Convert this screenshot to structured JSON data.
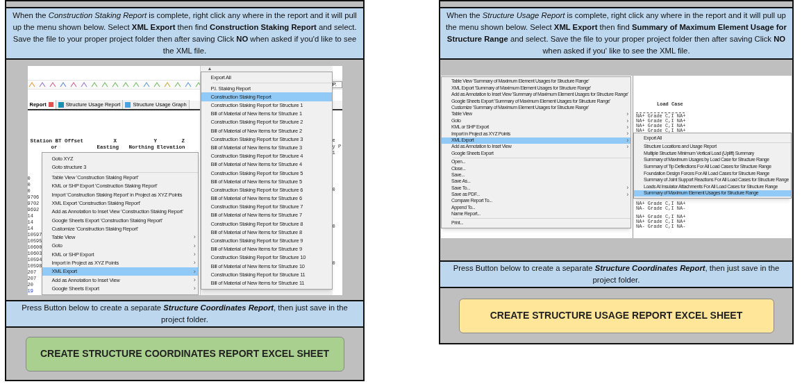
{
  "panels": [
    {
      "kind": "staking",
      "instructions": "When the *Construction Staking Report*  is complete, right click any where in the report and it will pull up the menu shown below. Select **XML Export** then find **Construction Staking Report**  and select. Save the file to your proper project folder then after saving Click **NO** when asked if you'd like to see the XML file.",
      "screenshot": {
        "tabs": [
          {
            "label": "Report",
            "selected": true
          },
          {
            "label": "Structure Usage Report",
            "selected": false
          },
          {
            "label": "Structure Usage Graph",
            "selected": false
          }
        ],
        "toolbar_field": "P.",
        "scroll_arrow": "▲",
        "submenu_arrow": "›",
        "header_row_1": [
          "Station BT Offset",
          "X",
          "Y",
          "Z"
        ],
        "header_row_2": [
          "or",
          "Easting",
          "Northing Elevation"
        ],
        "left_fragments": [
          "0",
          "0",
          "0",
          "9706",
          "9702",
          "9692",
          "14",
          "14",
          "14",
          "10597",
          "10595",
          "10600",
          "10603",
          "10594",
          "10598",
          "207",
          "207",
          "20",
          "19"
        ],
        "right_fragments": [
          "e",
          "y P",
          "1",
          "0",
          "0",
          "0"
        ],
        "menu": [
          {
            "label": "Goto XYZ",
            "kind": "item",
            "selected": false
          },
          {
            "label": "Goto structure 3",
            "kind": "item",
            "selected": false
          },
          {
            "kind": "separator"
          },
          {
            "label": "Table View 'Construction Staking Report'",
            "kind": "item",
            "selected": false
          },
          {
            "label": "KML or SHP Export 'Construction Staking Report'",
            "kind": "item",
            "selected": false
          },
          {
            "label": "Import 'Construction Staking Report' in Project as XYZ Points",
            "kind": "item",
            "selected": false
          },
          {
            "label": "XML Export 'Construction Staking Report'",
            "kind": "item",
            "selected": false
          },
          {
            "label": "Add as Annotation to Inset View 'Construction Staking Report'",
            "kind": "item",
            "selected": false
          },
          {
            "label": "Google Sheets Export 'Construction Staking Report'",
            "kind": "item",
            "selected": false
          },
          {
            "label": "Customize 'Construction Staking Report'",
            "kind": "item",
            "selected": false
          },
          {
            "label": "Table View",
            "kind": "submenu",
            "selected": false
          },
          {
            "label": "Goto",
            "kind": "submenu",
            "selected": false
          },
          {
            "label": "KML or SHP Export",
            "kind": "submenu",
            "selected": false
          },
          {
            "label": "Import in Project as XYZ Points",
            "kind": "submenu",
            "selected": false
          },
          {
            "label": "XML Export",
            "kind": "submenu",
            "selected": true
          },
          {
            "label": "Add as Annotation to Inset View",
            "kind": "submenu",
            "selected": false
          },
          {
            "label": "Google Sheets Export",
            "kind": "submenu",
            "selected": false
          }
        ],
        "submenu": [
          {
            "label": "Export All",
            "kind": "item",
            "selected": false
          },
          {
            "kind": "separator"
          },
          {
            "label": "P.I. Staking Report",
            "kind": "item",
            "selected": false
          },
          {
            "label": "Construction Staking Report",
            "kind": "item",
            "selected": true
          },
          {
            "label": "Construction Staking Report for Structure 1",
            "kind": "item",
            "selected": false
          },
          {
            "label": "Bill of Material of New Items for Structure 1",
            "kind": "item",
            "selected": false
          },
          {
            "label": "Construction Staking Report for Structure 2",
            "kind": "item",
            "selected": false
          },
          {
            "label": "Bill of Material of New Items for Structure 2",
            "kind": "item",
            "selected": false
          },
          {
            "label": "Construction Staking Report for Structure 3",
            "kind": "item",
            "selected": false
          },
          {
            "label": "Bill of Material of New Items for Structure 3",
            "kind": "item",
            "selected": false
          },
          {
            "label": "Construction Staking Report for Structure 4",
            "kind": "item",
            "selected": false
          },
          {
            "label": "Bill of Material of New Items for Structure 4",
            "kind": "item",
            "selected": false
          },
          {
            "label": "Construction Staking Report for Structure 5",
            "kind": "item",
            "selected": false
          },
          {
            "label": "Bill of Material of New Items for Structure 5",
            "kind": "item",
            "selected": false
          },
          {
            "label": "Construction Staking Report for Structure 6",
            "kind": "item",
            "selected": false
          },
          {
            "label": "Bill of Material of New Items for Structure 6",
            "kind": "item",
            "selected": false
          },
          {
            "label": "Construction Staking Report for Structure 7",
            "kind": "item",
            "selected": false
          },
          {
            "label": "Bill of Material of New Items for Structure 7",
            "kind": "item",
            "selected": false
          },
          {
            "label": "Construction Staking Report for Structure 8",
            "kind": "item",
            "selected": false
          },
          {
            "label": "Bill of Material of New Items for Structure 8",
            "kind": "item",
            "selected": false
          },
          {
            "label": "Construction Staking Report for Structure 9",
            "kind": "item",
            "selected": false
          },
          {
            "label": "Bill of Material of New Items for Structure 9",
            "kind": "item",
            "selected": false
          },
          {
            "label": "Construction Staking Report for Structure 10",
            "kind": "item",
            "selected": false
          },
          {
            "label": "Bill of Material of New Items for Structure 10",
            "kind": "item",
            "selected": false
          },
          {
            "label": "Construction Staking Report for Structure 11",
            "kind": "item",
            "selected": false
          },
          {
            "label": "Bill of Material of New Items for Structure 11",
            "kind": "item",
            "selected": false
          }
        ]
      },
      "caption": "Press Button below to create a separate **Structure Coordinates Report**, then just save in the project folder.",
      "button": {
        "label": "CREATE STRUCTURE COORDINATES REPORT EXCEL SHEET",
        "color": "#a9d08e"
      }
    },
    {
      "kind": "usage",
      "instructions": "When the *Structure Usage Report*  is complete, right click any where in the report and it will pull up the menu shown below. Select **XML Export** then find **Summary of Maximum Element Usage for Structure Range**  and select. Save the file to your proper project folder then after saving Click **NO** when asked if you' like to see the XML file.",
      "screenshot": {
        "report_title": "Load Case",
        "report_lines_top": [
          "NA+ Grade C,I NA+",
          "NA+ Grade C,I NA+",
          "NA+ Grade C,I NA+",
          "NA+ Grade C,I NA+"
        ],
        "report_lines_bottom": [
          "NA+ Grade C,I NA+",
          "NA- Grade C,I NA-"
        ],
        "report_lines_end": [
          "NA+ Grade C,I NA+",
          "NA+ Grade C,I NA+",
          "NA- Grade C,I NA-"
        ],
        "submenu_arrow": "›",
        "menu": [
          {
            "label": "Table View 'Summary of Maximum Element Usages for Structure Range'",
            "kind": "item",
            "selected": false
          },
          {
            "label": "XML Export 'Summary of Maximum Element Usages for Structure Range'",
            "kind": "item",
            "selected": false
          },
          {
            "label": "Add as Annotation to Inset View 'Summary of Maximum Element Usages for Structure Range'",
            "kind": "item",
            "selected": false
          },
          {
            "label": "Google Sheets Export 'Summary of Maximum Element Usages for Structure Range'",
            "kind": "item",
            "selected": false
          },
          {
            "label": "Customize 'Summary of Maximum Element Usages for Structure Range'",
            "kind": "item",
            "selected": false
          },
          {
            "label": "Table View",
            "kind": "submenu",
            "selected": false
          },
          {
            "label": "Goto",
            "kind": "submenu",
            "selected": false
          },
          {
            "label": "KML or SHP Export",
            "kind": "submenu",
            "selected": false
          },
          {
            "label": "Import in Project as XYZ Points",
            "kind": "submenu",
            "selected": false
          },
          {
            "label": "XML Export",
            "kind": "submenu",
            "selected": true
          },
          {
            "label": "Add as Annotation to Inset View",
            "kind": "submenu",
            "selected": false
          },
          {
            "label": "Google Sheets Export",
            "kind": "item",
            "selected": false
          },
          {
            "kind": "separator"
          },
          {
            "label": "Open...",
            "kind": "item",
            "selected": false
          },
          {
            "label": "Close...",
            "kind": "item",
            "selected": false
          },
          {
            "label": "Save...",
            "kind": "item",
            "selected": false
          },
          {
            "label": "Save As...",
            "kind": "item",
            "selected": false
          },
          {
            "label": "Save To...",
            "kind": "submenu",
            "selected": false
          },
          {
            "label": "Save as PDF...",
            "kind": "submenu",
            "selected": false
          },
          {
            "label": "Compare Report To...",
            "kind": "item",
            "selected": false
          },
          {
            "label": "Append To...",
            "kind": "item",
            "selected": false
          },
          {
            "label": "Name Report...",
            "kind": "item",
            "selected": false
          },
          {
            "kind": "separator"
          },
          {
            "label": "Print...",
            "kind": "item",
            "selected": false
          }
        ],
        "submenu": [
          {
            "label": "Export All",
            "kind": "item",
            "selected": false
          },
          {
            "kind": "separator"
          },
          {
            "label": "Structure Locations and Usage Report",
            "kind": "item",
            "selected": false
          },
          {
            "label": "Multiple Structure Minimum Vertical Load (Uplift) Summary",
            "kind": "item",
            "selected": false
          },
          {
            "label": "Summary of Maximum Usages by Load Case for Structure Range",
            "kind": "item",
            "selected": false
          },
          {
            "label": "Summary of Tip Deflections For All Load Cases for Structure Range",
            "kind": "item",
            "selected": false
          },
          {
            "label": "Foundation Design Forces For All Load Cases for Structure Range",
            "kind": "item",
            "selected": false
          },
          {
            "label": "Summary of Joint Support Reactions For All Load Cases for Structure Range",
            "kind": "item",
            "selected": false
          },
          {
            "label": "Loads At Insulator Attachments For All Load Cases for Structure Range",
            "kind": "item",
            "selected": false
          },
          {
            "label": "Summary of Maximum Element Usages for Structure Range",
            "kind": "item",
            "selected": true
          }
        ]
      },
      "caption": "Press Button below to create a separate **Structure Coordinates Report**, then just save in the project folder.",
      "button": {
        "label": "CREATE STRUCTURE USAGE REPORT EXCEL SHEET",
        "color": "#ffe699"
      }
    }
  ]
}
